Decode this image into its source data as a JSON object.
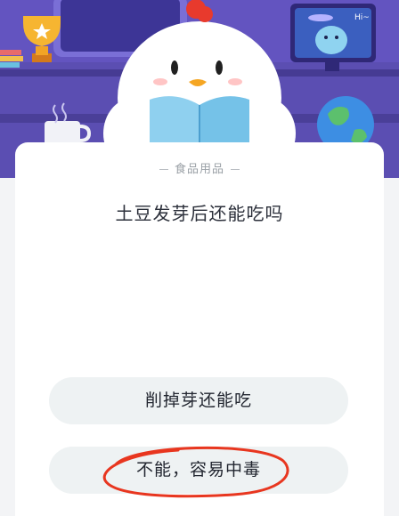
{
  "banner": {
    "speech_text": "Hi~"
  },
  "quiz": {
    "category": "食品用品",
    "question": "土豆发芽后还能吃吗",
    "options": [
      {
        "label": "削掉芽还能吃"
      },
      {
        "label": "不能，容易中毒"
      }
    ]
  },
  "colors": {
    "banner_bg": "#5a4fb0",
    "card_bg": "#ffffff",
    "option_bg": "#eef2f3",
    "annotation": "#e8361f"
  }
}
